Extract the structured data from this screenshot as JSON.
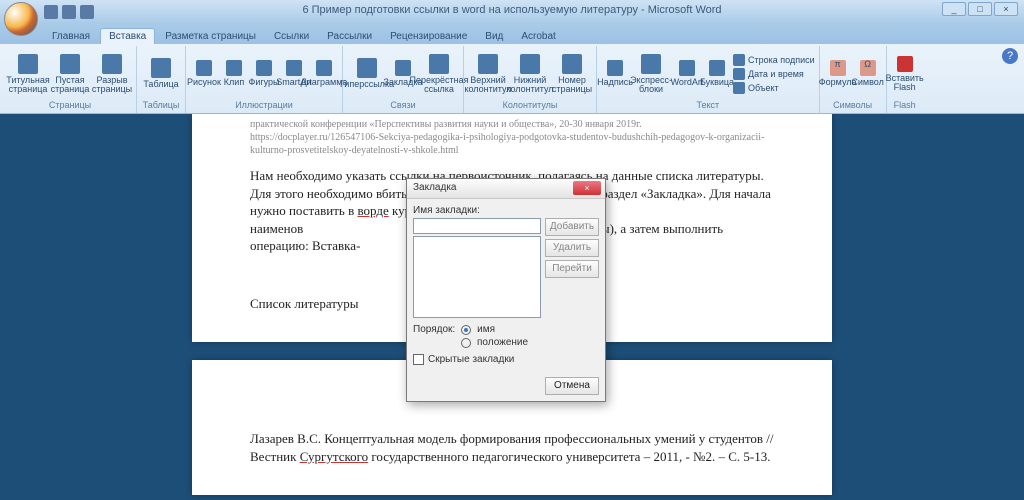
{
  "titlebar": {
    "doc_title": "6 Пример подготовки ссылки в word на используемую литературу - Microsoft Word"
  },
  "win": {
    "min": "_",
    "max": "□",
    "close": "×"
  },
  "tabs": {
    "home": "Главная",
    "insert": "Вставка",
    "layout": "Разметка страницы",
    "refs": "Ссылки",
    "mail": "Рассылки",
    "review": "Рецензирование",
    "view": "Вид",
    "acrobat": "Acrobat"
  },
  "ribbon": {
    "groups": {
      "pages": "Страницы",
      "tables": "Таблицы",
      "illustr": "Иллюстрации",
      "links": "Связи",
      "hf": "Колонтитулы",
      "text": "Текст",
      "symbols": "Символы",
      "flash": "Flash"
    },
    "btns": {
      "cover": "Титульная страница",
      "blank": "Пустая страница",
      "break": "Разрыв страницы",
      "table": "Таблица",
      "pic": "Рисунок",
      "clip": "Клип",
      "shapes": "Фигуры",
      "smart": "SmartArt",
      "chart": "Диаграмма",
      "hyper": "Гиперссылка",
      "bm": "Закладка",
      "xref": "Перекрёстная ссылка",
      "header": "Верхний колонтитул",
      "footer": "Нижний колонтитул",
      "pnum": "Номер страницы",
      "tb": "Надпись",
      "quick": "Экспресс-блоки",
      "wa": "WordArt",
      "drop": "Буквица",
      "sig": "Строка подписи",
      "dt": "Дата и время",
      "obj": "Объект",
      "eq": "Формула",
      "sym": "Символ",
      "flash": "Вставить Flash"
    }
  },
  "doc": {
    "gray1": "практической конференции «Перспективы развития науки и общества», 20-30 января 2019г.",
    "gray2": "https://docplayer.ru/126547106-Sekciya-pedagogika-i-psihologiya-podgotovka-studentov-budushchih-pedagogov-k-organizacii-kulturno-prosvetitelskoy-deyatelnosti-v-shkole.html",
    "p1a": "Нам необходимо указать ссылки на первоисточник, полагаясь на данные списка литературы. Для этого необходимо вбить нужные источники информации в раздел «Закладка». Для начала нужно поставить в ",
    "p1b": "ворде",
    "p1c": " курсор на наименов",
    "p1d": "ры), а затем выполнить операцию: Вставка-",
    "bib": "Список литературы",
    "p2a": "Лазарев В.С. Концептуальная модель формирования профессиональных умений у студентов // Вестник ",
    "p2b": "Сургутского",
    "p2c": " государственного педагогического университета – 2011, - №2. – С. 5-13."
  },
  "dialog": {
    "title": "Закладка",
    "name_label": "Имя закладки:",
    "add": "Добавить",
    "del": "Удалить",
    "go": "Перейти",
    "sort": "Порядок:",
    "by_name": "имя",
    "by_loc": "положение",
    "hidden": "Скрытые закладки",
    "cancel": "Отмена"
  }
}
